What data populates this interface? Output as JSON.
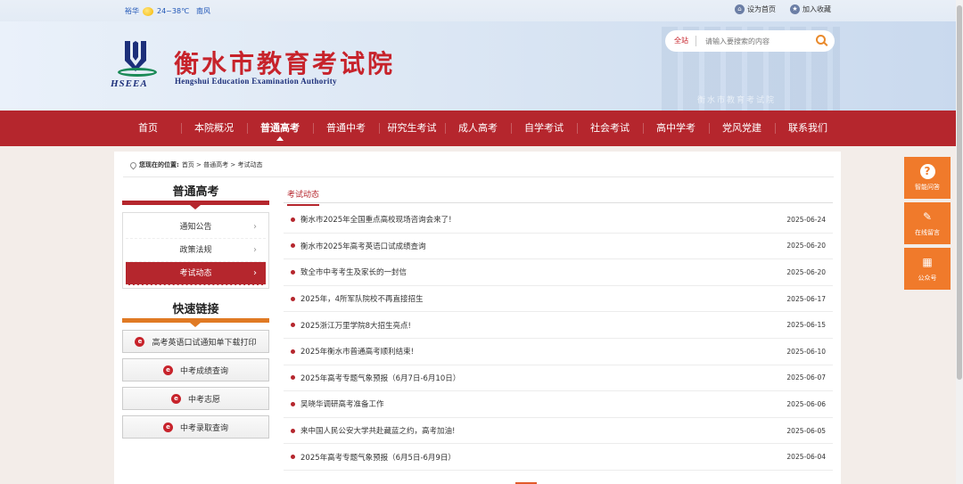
{
  "topbar": {
    "city": "裕华",
    "temperature": "24~38℃",
    "wind": "南风",
    "set_home": "设为首页",
    "add_favorite": "加入收藏"
  },
  "header": {
    "site_name": "衡水市教育考试院",
    "site_name_en": "Hengshui Education Examination Authority",
    "logo_abbr": "HSEEA",
    "building_sign": "衡水市教育考试院",
    "search": {
      "scope": "全站",
      "placeholder": "请输入要搜索的内容"
    }
  },
  "nav": {
    "items": [
      "首页",
      "本院概况",
      "普通高考",
      "普通中考",
      "研究生考试",
      "成人高考",
      "自学考试",
      "社会考试",
      "高中学考",
      "党风党建",
      "联系我们"
    ],
    "active_index": 2
  },
  "breadcrumb": {
    "label": "您现在的位置:",
    "path": "首页 > 普通高考 > 考试动态"
  },
  "sidebar": {
    "title": "普通高考",
    "items": [
      {
        "label": "通知公告",
        "arrow": "›"
      },
      {
        "label": "政策法规",
        "arrow": "›"
      },
      {
        "label": "考试动态",
        "arrow": "›"
      }
    ],
    "active_index": 2,
    "quick_title": "快速链接",
    "quick_links": [
      "高考英语口试通知单下载打印",
      "中考成绩查询",
      "中考志愿",
      "中考录取查询"
    ]
  },
  "main": {
    "tab": "考试动态",
    "articles": [
      {
        "title": "衡水市2025年全国重点高校现场咨询会来了!",
        "date": "2025-06-24"
      },
      {
        "title": "衡水市2025年高考英语口试成绩查询",
        "date": "2025-06-20"
      },
      {
        "title": "致全市中考考生及家长的一封信",
        "date": "2025-06-20"
      },
      {
        "title": "2025年，4所军队院校不再直接招生",
        "date": "2025-06-17"
      },
      {
        "title": "2025浙江万里学院8大招生亮点!",
        "date": "2025-06-15"
      },
      {
        "title": "2025年衡水市普通高考顺利结束!",
        "date": "2025-06-10"
      },
      {
        "title": "2025年高考专题气象预报（6月7日-6月10日）",
        "date": "2025-06-07"
      },
      {
        "title": "吴晓华调研高考准备工作",
        "date": "2025-06-06"
      },
      {
        "title": "来中国人民公安大学共赴藏蓝之约，高考加油!",
        "date": "2025-06-05"
      },
      {
        "title": "2025年高考专题气象预报（6月5日-6月9日）",
        "date": "2025-06-04"
      }
    ]
  },
  "float_tools": [
    {
      "label": "智能问答",
      "icon": "question-icon",
      "glyph": "?"
    },
    {
      "label": "在线留言",
      "icon": "edit-icon",
      "glyph": "✎"
    },
    {
      "label": "公众号",
      "icon": "qrcode-icon",
      "glyph": "▦"
    }
  ],
  "colors": {
    "brand_red": "#b5262d",
    "accent_orange": "#f07a2b"
  }
}
